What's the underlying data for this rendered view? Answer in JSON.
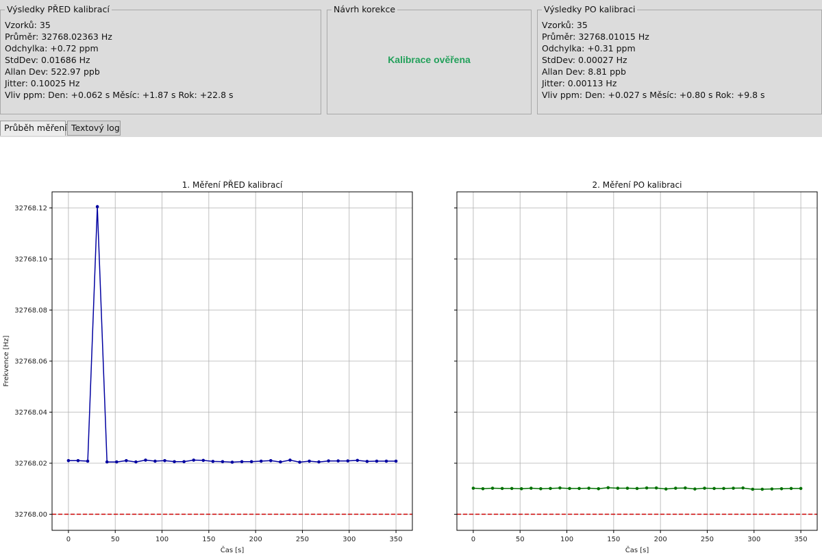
{
  "before": {
    "title": "Výsledky PŘED kalibrací",
    "lines": [
      "Vzorků: 35",
      "Průměr: 32768.02363 Hz",
      "Odchylka: +0.72 ppm",
      "StdDev: 0.01686 Hz",
      "Allan Dev: 522.97 ppb",
      "Jitter: 0.10025 Hz",
      "Vliv ppm: Den: +0.062 s Měsíc: +1.87 s Rok: +22.8 s"
    ]
  },
  "correction": {
    "title": "Návrh korekce",
    "status": "Kalibrace ověřena",
    "status_color": "#22a05a"
  },
  "after": {
    "title": "Výsledky PO kalibraci",
    "lines": [
      "Vzorků: 35",
      "Průměr: 32768.01015 Hz",
      "Odchylka: +0.31 ppm",
      "StdDev: 0.00027 Hz",
      "Allan Dev: 8.81 ppb",
      "Jitter: 0.00113 Hz",
      "Vliv ppm: Den: +0.027 s Měsíc: +0.80 s Rok: +9.8 s"
    ]
  },
  "tabs": [
    {
      "label": "Průběh měření",
      "active": true
    },
    {
      "label": "Textový log",
      "active": false
    }
  ],
  "chart_data": [
    {
      "type": "line",
      "title": "1. Měření PŘED kalibrací",
      "xlabel": "Čas [s]",
      "ylabel": "Frekvence [Hz]",
      "xlim": [
        -17.5,
        367.5
      ],
      "ylim": [
        32767.9937,
        32768.1263
      ],
      "xticks": [
        0,
        50,
        100,
        150,
        200,
        250,
        300,
        350
      ],
      "yticks": [
        32768.0,
        32768.02,
        32768.04,
        32768.06,
        32768.08,
        32768.1,
        32768.12
      ],
      "ytick_labels": [
        "32768.00",
        "32768.02",
        "32768.04",
        "32768.06",
        "32768.08",
        "32768.10",
        "32768.12"
      ],
      "grid": true,
      "line_color": "#0000a0",
      "reference_line": {
        "y": 32768.0,
        "color": "#cc0000",
        "style": "dashed"
      },
      "x": [
        0,
        10.3,
        20.6,
        30.9,
        41.2,
        51.5,
        61.8,
        72.1,
        82.4,
        92.6,
        102.9,
        113.2,
        123.5,
        133.8,
        144.1,
        154.4,
        164.7,
        175.0,
        185.3,
        195.6,
        205.9,
        216.2,
        226.5,
        236.8,
        247.1,
        257.4,
        267.6,
        277.9,
        288.2,
        298.5,
        308.8,
        319.1,
        329.4,
        339.7,
        350.0
      ],
      "values": [
        32768.021,
        32768.021,
        32768.0208,
        32768.1205,
        32768.0205,
        32768.0205,
        32768.021,
        32768.0205,
        32768.0212,
        32768.0208,
        32768.021,
        32768.0206,
        32768.0206,
        32768.0212,
        32768.0211,
        32768.0207,
        32768.0206,
        32768.0204,
        32768.0206,
        32768.0206,
        32768.0208,
        32768.021,
        32768.0205,
        32768.0212,
        32768.0204,
        32768.0208,
        32768.0205,
        32768.0209,
        32768.0209,
        32768.0209,
        32768.0211,
        32768.0207,
        32768.0208,
        32768.0208,
        32768.0208
      ]
    },
    {
      "type": "line",
      "title": "2. Měření PO kalibraci",
      "xlabel": "Čas [s]",
      "ylabel": "",
      "xlim": [
        -17.5,
        367.5
      ],
      "ylim": [
        32767.9937,
        32768.1263
      ],
      "xticks": [
        0,
        50,
        100,
        150,
        200,
        250,
        300,
        350
      ],
      "yticks": [
        32768.0,
        32768.02,
        32768.04,
        32768.06,
        32768.08,
        32768.1,
        32768.12
      ],
      "grid": true,
      "line_color": "#007000",
      "reference_line": {
        "y": 32768.0,
        "color": "#cc0000",
        "style": "dashed"
      },
      "x": [
        0,
        10.3,
        20.6,
        30.9,
        41.2,
        51.5,
        61.8,
        72.1,
        82.4,
        92.6,
        102.9,
        113.2,
        123.5,
        133.8,
        144.1,
        154.4,
        164.7,
        175.0,
        185.3,
        195.6,
        205.9,
        216.2,
        226.5,
        236.8,
        247.1,
        257.4,
        267.6,
        277.9,
        288.2,
        298.5,
        308.8,
        319.1,
        329.4,
        339.7,
        350.0
      ],
      "values": [
        32768.0102,
        32768.01,
        32768.0102,
        32768.0101,
        32768.0101,
        32768.01,
        32768.0102,
        32768.01,
        32768.0101,
        32768.0103,
        32768.0101,
        32768.0101,
        32768.0102,
        32768.01,
        32768.0104,
        32768.0102,
        32768.0102,
        32768.0101,
        32768.0103,
        32768.0103,
        32768.0099,
        32768.0102,
        32768.0103,
        32768.0099,
        32768.0102,
        32768.0101,
        32768.0101,
        32768.0102,
        32768.0103,
        32768.0098,
        32768.0098,
        32768.0099,
        32768.01,
        32768.0101,
        32768.0101
      ]
    }
  ]
}
